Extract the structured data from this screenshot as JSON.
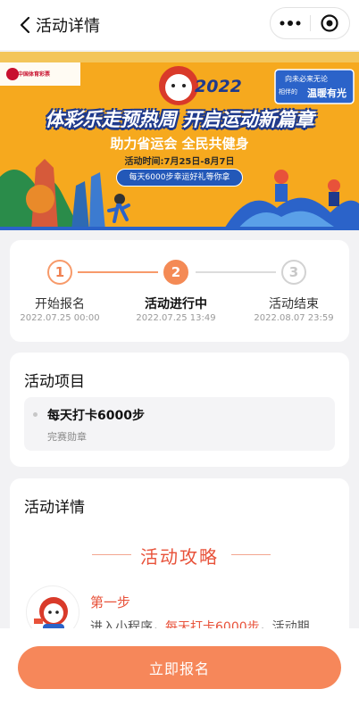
{
  "nav": {
    "title": "活动详情",
    "back_icon": "chevron-left-icon",
    "more_icon": "more-dots-icon",
    "target_icon": "target-circle-icon"
  },
  "banner": {
    "logo_text": "中国体育彩票",
    "year": "2022",
    "slogan_line1": "向未必来无论",
    "slogan_line2": "温暖有光",
    "slogan_line3": "相伴的",
    "headline": "体彩乐走预热周 开启运动新篇章",
    "subhead": "助力省运会 全民共健身",
    "time": "活动时间:7月25日-8月7日",
    "pill": "每天6000步幸运好礼等你拿"
  },
  "progress": {
    "steps": [
      {
        "num": "1",
        "name": "开始报名",
        "date": "2022.07.25 00:00"
      },
      {
        "num": "2",
        "name": "活动进行中",
        "date": "2022.07.25 13:49"
      },
      {
        "num": "3",
        "name": "活动结束",
        "date": "2022.08.07 23:59"
      }
    ],
    "active_step": 2
  },
  "project": {
    "title": "活动项目",
    "item_name": "每天打卡6000步",
    "item_badge": "完赛勋章"
  },
  "detail": {
    "title": "活动详情",
    "guide_title": "活动攻略",
    "step_label": "第一步",
    "step_text_prefix": "进入小程序，",
    "step_text_highlight": "每天打卡6000步",
    "step_text_suffix": "，活动期"
  },
  "cta": {
    "label": "立即报名"
  },
  "colors": {
    "accent": "#f6875a",
    "highlight": "#e8523a",
    "banner_bg": "#f6a91e"
  }
}
